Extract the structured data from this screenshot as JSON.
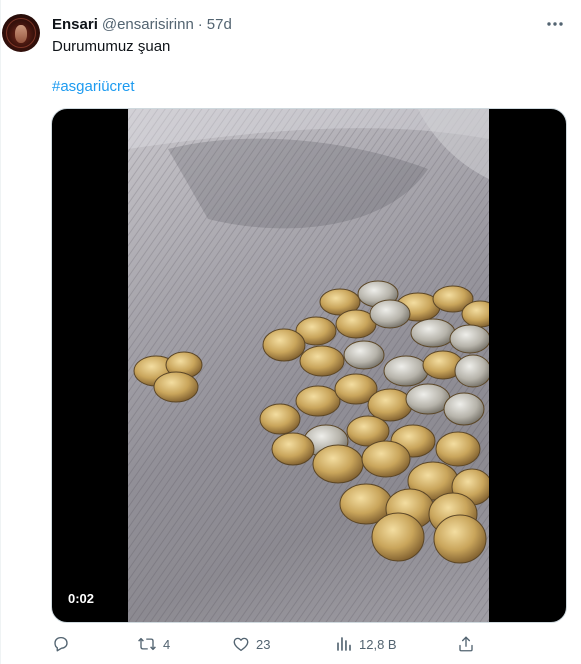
{
  "tweet": {
    "author_name": "Ensari",
    "handle": "@ensarisirinn",
    "separator": "·",
    "time": "57d",
    "text": "Durumumuz şuan",
    "hashtag": "#asgariücret",
    "video": {
      "duration": "0:02"
    },
    "actions": {
      "reply": {
        "icon": "reply-icon",
        "count": ""
      },
      "retweet": {
        "icon": "retweet-icon",
        "count": "4"
      },
      "like": {
        "icon": "heart-icon",
        "count": "23"
      },
      "views": {
        "icon": "analytics-icon",
        "count": "12,8 B"
      },
      "share": {
        "icon": "share-icon",
        "count": ""
      }
    }
  },
  "colors": {
    "text_primary": "#0f1419",
    "text_secondary": "#536471",
    "link": "#1d9bf0",
    "border": "#cfd9de"
  }
}
